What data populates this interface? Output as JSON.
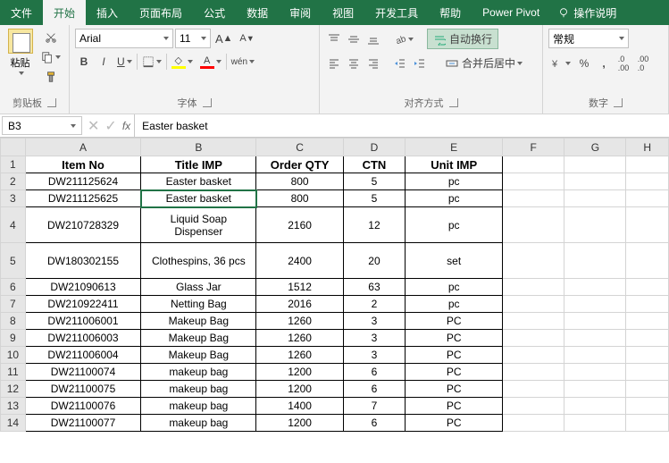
{
  "tabs": {
    "file": "文件",
    "home": "开始",
    "insert": "插入",
    "layout": "页面布局",
    "formulas": "公式",
    "data": "数据",
    "review": "审阅",
    "view": "视图",
    "dev": "开发工具",
    "help": "帮助",
    "pivot": "Power Pivot",
    "tell": "操作说明"
  },
  "ribbon": {
    "clipboard": {
      "paste": "粘贴",
      "label": "剪贴板"
    },
    "font": {
      "name": "Arial",
      "size": "11",
      "label": "字体",
      "wen": "wén"
    },
    "align": {
      "wrap": "自动换行",
      "merge": "合并后居中",
      "label": "对齐方式"
    },
    "number": {
      "format": "常规",
      "label": "数字"
    }
  },
  "fbar": {
    "ref": "B3",
    "fx": "fx",
    "value": "Easter basket"
  },
  "cols": [
    "A",
    "B",
    "C",
    "D",
    "E",
    "F",
    "G",
    "H"
  ],
  "headers": [
    "Item No",
    "Title IMP",
    "Order QTY",
    "CTN",
    "Unit IMP"
  ],
  "rows": [
    {
      "r": "1"
    },
    {
      "r": "2",
      "d": [
        "DW211125624",
        "Easter basket",
        "800",
        "5",
        "pc"
      ]
    },
    {
      "r": "3",
      "d": [
        "DW211125625",
        "Easter basket",
        "800",
        "5",
        "pc"
      ]
    },
    {
      "r": "4",
      "d": [
        "DW210728329",
        "Liquid Soap Dispenser",
        "2160",
        "12",
        "pc"
      ],
      "tall": true
    },
    {
      "r": "5",
      "d": [
        "DW180302155",
        "Clothespins, 36 pcs",
        "2400",
        "20",
        "set"
      ],
      "tall": true
    },
    {
      "r": "6",
      "d": [
        "DW21090613",
        "Glass Jar",
        "1512",
        "63",
        "pc"
      ]
    },
    {
      "r": "7",
      "d": [
        "DW210922411",
        "Netting Bag",
        "2016",
        "2",
        "pc"
      ]
    },
    {
      "r": "8",
      "d": [
        "DW211006001",
        "Makeup Bag",
        "1260",
        "3",
        "PC"
      ]
    },
    {
      "r": "9",
      "d": [
        "DW211006003",
        "Makeup Bag",
        "1260",
        "3",
        "PC"
      ]
    },
    {
      "r": "10",
      "d": [
        "DW211006004",
        "Makeup Bag",
        "1260",
        "3",
        "PC"
      ]
    },
    {
      "r": "11",
      "d": [
        "DW21100074",
        "makeup bag",
        "1200",
        "6",
        "PC"
      ]
    },
    {
      "r": "12",
      "d": [
        "DW21100075",
        "makeup bag",
        "1200",
        "6",
        "PC"
      ]
    },
    {
      "r": "13",
      "d": [
        "DW21100076",
        "makeup bag",
        "1400",
        "7",
        "PC"
      ]
    },
    {
      "r": "14",
      "d": [
        "DW21100077",
        "makeup bag",
        "1200",
        "6",
        "PC"
      ]
    }
  ],
  "chart_data": {
    "type": "table",
    "columns": [
      "Item No",
      "Title IMP",
      "Order QTY",
      "CTN",
      "Unit IMP"
    ],
    "rows": [
      [
        "DW211125624",
        "Easter basket",
        800,
        5,
        "pc"
      ],
      [
        "DW211125625",
        "Easter basket",
        800,
        5,
        "pc"
      ],
      [
        "DW210728329",
        "Liquid Soap Dispenser",
        2160,
        12,
        "pc"
      ],
      [
        "DW180302155",
        "Clothespins, 36 pcs",
        2400,
        20,
        "set"
      ],
      [
        "DW21090613",
        "Glass Jar",
        1512,
        63,
        "pc"
      ],
      [
        "DW210922411",
        "Netting Bag",
        2016,
        2,
        "pc"
      ],
      [
        "DW211006001",
        "Makeup Bag",
        1260,
        3,
        "PC"
      ],
      [
        "DW211006003",
        "Makeup Bag",
        1260,
        3,
        "PC"
      ],
      [
        "DW211006004",
        "Makeup Bag",
        1260,
        3,
        "PC"
      ],
      [
        "DW21100074",
        "makeup bag",
        1200,
        6,
        "PC"
      ],
      [
        "DW21100075",
        "makeup bag",
        1200,
        6,
        "PC"
      ],
      [
        "DW21100076",
        "makeup bag",
        1400,
        7,
        "PC"
      ],
      [
        "DW21100077",
        "makeup bag",
        1200,
        6,
        "PC"
      ]
    ]
  }
}
